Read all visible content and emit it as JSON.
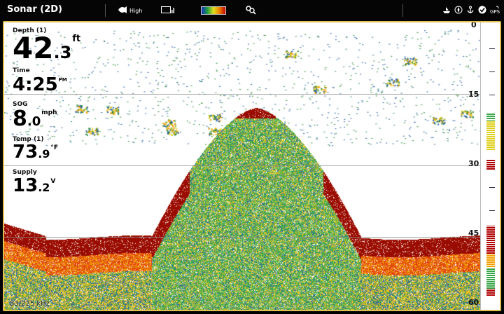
{
  "topbar": {
    "title": "Sonar (2D)",
    "sensitivity_label": "High",
    "icons": [
      "fish-icon",
      "chart-view-icon",
      "palette-icon",
      "settings-search-icon",
      "boat-icon",
      "compass-icon",
      "anchor-icon",
      "check-icon",
      "gps-icon"
    ]
  },
  "readouts": {
    "depth": {
      "label": "Depth (1)",
      "value_big": "42",
      "value_small": ".3",
      "unit": "ft"
    },
    "time": {
      "label": "Time",
      "value_big": "4:25",
      "unit": "PM"
    },
    "sog": {
      "label": "SOG",
      "value_big": "8",
      "value_small": ".0",
      "unit": "mph"
    },
    "temp": {
      "label": "Temp (1)",
      "value_big": "73",
      "value_small": ".9",
      "unit": "°F"
    },
    "supply": {
      "label": "Supply",
      "value_big": "13",
      "value_small": ".2",
      "unit": "V"
    }
  },
  "scale": {
    "labels": [
      "0",
      "15",
      "30",
      "45",
      "60"
    ],
    "max_depth": 60
  },
  "frequency": "83/225 kHz",
  "colors": {
    "background": "#ffffff",
    "bottom_hard": "#9b0c00",
    "signal_mid": "#f2a000",
    "signal_low": "#3aa84a",
    "frame": "#e0c050"
  },
  "seafloor": {
    "base_depth_ft": 46,
    "hump_top_ft": 18
  }
}
